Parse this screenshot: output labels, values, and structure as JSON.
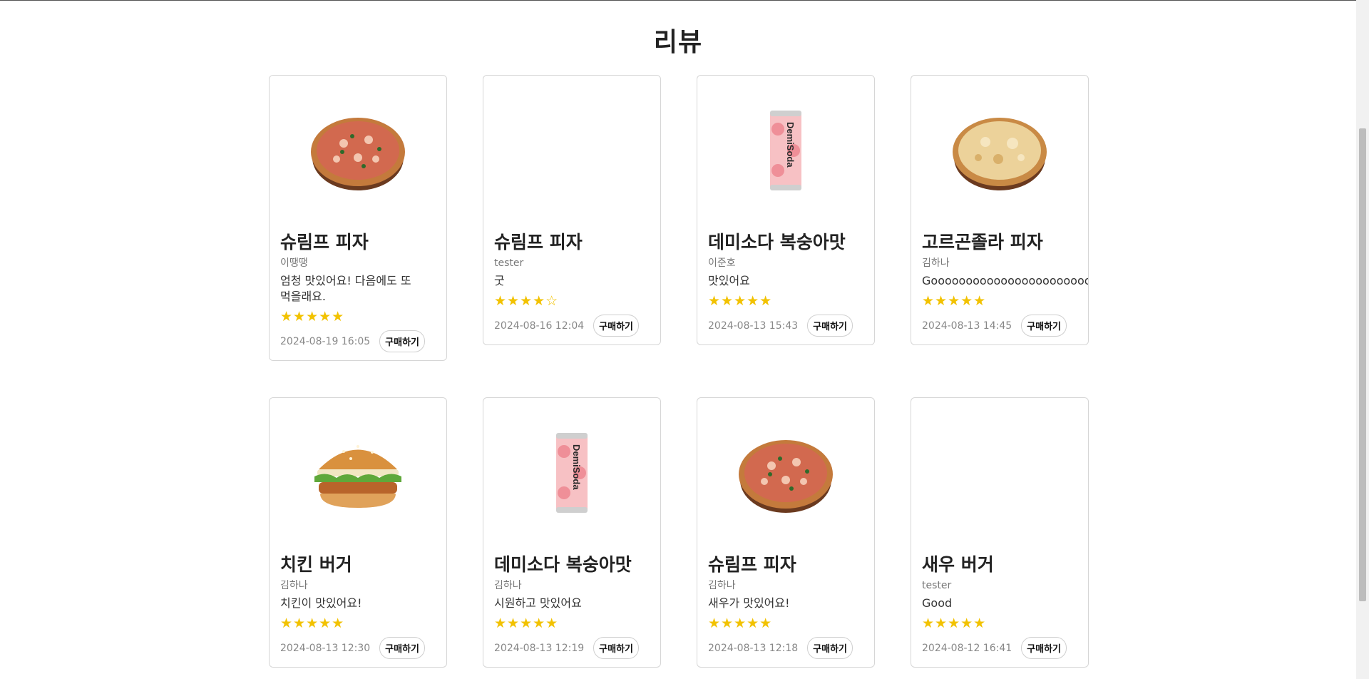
{
  "page": {
    "title": "리뷰"
  },
  "reviews": [
    {
      "name": "슈림프 피자",
      "author": "이땡땡",
      "comment": "엄청 맛있어요! 다음에도 또 먹을래요.",
      "stars": "★★★★★",
      "rating": 5,
      "date": "2024-08-19 16:05",
      "buy_label": "구매하기",
      "image": "pizza-red"
    },
    {
      "name": "슈림프 피자",
      "author": "tester",
      "comment": "굿",
      "stars": "★★★★☆",
      "rating": 4,
      "date": "2024-08-16 12:04",
      "buy_label": "구매하기",
      "image": "none"
    },
    {
      "name": "데미소다 복숭아맛",
      "author": "이준호",
      "comment": "맛있어요",
      "stars": "★★★★★",
      "rating": 5,
      "date": "2024-08-13 15:43",
      "buy_label": "구매하기",
      "image": "soda-can"
    },
    {
      "name": "고르곤졸라 피자",
      "author": "김하나",
      "comment": "Goooooooooooooooooooooooooood",
      "stars": "★★★★★",
      "rating": 5,
      "date": "2024-08-13 14:45",
      "buy_label": "구매하기",
      "image": "pizza-cheese"
    },
    {
      "name": "치킨 버거",
      "author": "김하나",
      "comment": "치킨이 맛있어요!",
      "stars": "★★★★★",
      "rating": 5,
      "date": "2024-08-13 12:30",
      "buy_label": "구매하기",
      "image": "burger"
    },
    {
      "name": "데미소다 복숭아맛",
      "author": "김하나",
      "comment": "시원하고 맛있어요",
      "stars": "★★★★★",
      "rating": 5,
      "date": "2024-08-13 12:19",
      "buy_label": "구매하기",
      "image": "soda-can"
    },
    {
      "name": "슈림프 피자",
      "author": "김하나",
      "comment": "새우가 맛있어요!",
      "stars": "★★★★★",
      "rating": 5,
      "date": "2024-08-13 12:18",
      "buy_label": "구매하기",
      "image": "pizza-red"
    },
    {
      "name": "새우 버거",
      "author": "tester",
      "comment": "Good",
      "stars": "★★★★★",
      "rating": 5,
      "date": "2024-08-12 16:41",
      "buy_label": "구매하기",
      "image": "none"
    }
  ],
  "product_images": {
    "soda_brand": "DemiSoda"
  },
  "colors": {
    "star": "#f2c200",
    "border": "#d6d6d6"
  }
}
